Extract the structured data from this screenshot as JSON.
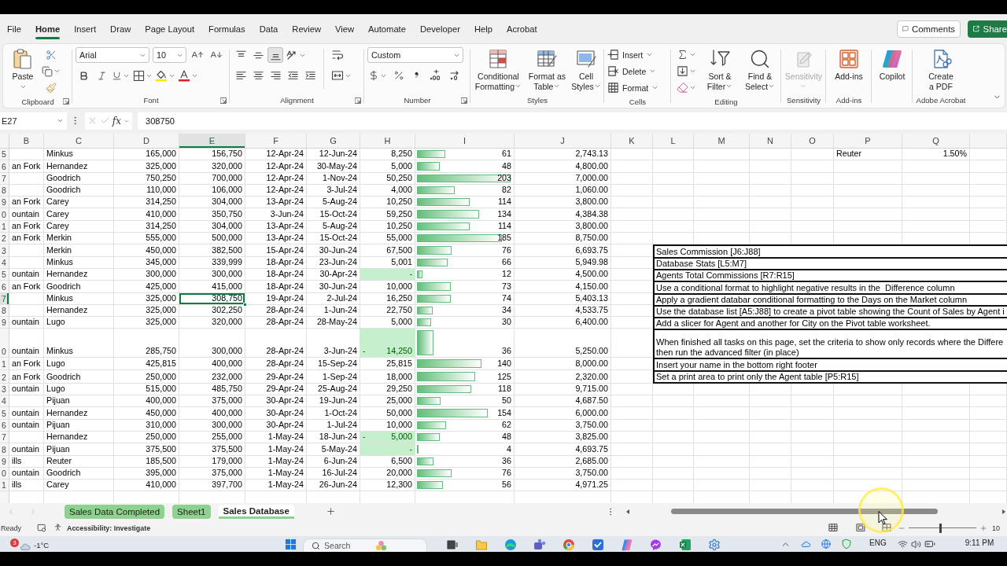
{
  "menu": {
    "tabs": [
      {
        "label": "File",
        "selected": false
      },
      {
        "label": "Home",
        "selected": true
      },
      {
        "label": "Insert",
        "selected": false
      },
      {
        "label": "Draw",
        "selected": false
      },
      {
        "label": "Page Layout",
        "selected": false
      },
      {
        "label": "Formulas",
        "selected": false
      },
      {
        "label": "Data",
        "selected": false
      },
      {
        "label": "Review",
        "selected": false
      },
      {
        "label": "View",
        "selected": false
      },
      {
        "label": "Automate",
        "selected": false
      },
      {
        "label": "Developer",
        "selected": false
      },
      {
        "label": "Help",
        "selected": false
      },
      {
        "label": "Acrobat",
        "selected": false
      }
    ],
    "comments": "Comments",
    "share": "Share"
  },
  "ribbon": {
    "clipboard": {
      "label": "Clipboard",
      "paste": "Paste"
    },
    "font": {
      "label": "Font",
      "font_name": "Arial",
      "font_size": "10"
    },
    "alignment": {
      "label": "Alignment",
      "vertical": [
        {
          "kind": "top",
          "selected": false
        },
        {
          "kind": "middle",
          "selected": false
        },
        {
          "kind": "bottom",
          "selected": true
        }
      ]
    },
    "number": {
      "label": "Number",
      "format": "Custom"
    },
    "styles": {
      "label": "Styles",
      "conditional_formatting": [
        "Conditional",
        "Formatting"
      ],
      "format_as_table": [
        "Format as",
        "Table"
      ],
      "cell_styles": [
        "Cell",
        "Styles"
      ]
    },
    "cells": {
      "label": "Cells",
      "insert": "Insert",
      "delete": "Delete",
      "format": "Format"
    },
    "editing": {
      "label": "Editing",
      "sort_filter": [
        "Sort &",
        "Filter"
      ],
      "find_select": [
        "Find &",
        "Select"
      ]
    },
    "sensitivity": {
      "label": "Sensitivity",
      "button": "Sensitivity",
      "disabled": true
    },
    "add_ins": {
      "label": "Add-ins",
      "button": "Add-ins"
    },
    "copilot": {
      "button": "Copilot"
    },
    "adobe_acrobat": {
      "label": "Adobe Acrobat",
      "create_pdf": [
        "Create",
        "a PDF"
      ]
    }
  },
  "formula_bar": {
    "name_box": "E27",
    "fx": "fx",
    "formula": "308750"
  },
  "sheet": {
    "columns": [
      {
        "label": "B",
        "selected": false
      },
      {
        "label": "C",
        "selected": false
      },
      {
        "label": "D",
        "selected": false
      },
      {
        "label": "E",
        "selected": true
      },
      {
        "label": "F",
        "selected": false
      },
      {
        "label": "G",
        "selected": false
      },
      {
        "label": "H",
        "selected": false
      },
      {
        "label": "I",
        "selected": false
      },
      {
        "label": "J",
        "selected": false
      },
      {
        "label": "K",
        "selected": false
      },
      {
        "label": "L",
        "selected": false
      },
      {
        "label": "M",
        "selected": false
      },
      {
        "label": "N",
        "selected": false
      },
      {
        "label": "O",
        "selected": false
      },
      {
        "label": "P",
        "selected": false
      },
      {
        "label": "Q",
        "selected": false
      }
    ],
    "rows": [
      {
        "header": "5",
        "selected": false,
        "c": "Minkus",
        "d": "165,000",
        "e": "156,750",
        "f": "12-Apr-24",
        "g": "12-Jun-24",
        "h": "8,250",
        "h_highlighted": false,
        "i": "61",
        "level": 0.3,
        "j": "2,743.13",
        "p": "Reuter",
        "q": "1.50%"
      },
      {
        "header": "6",
        "selected": false,
        "b": "an Fork",
        "c": "Hernandez",
        "d": "325,000",
        "e": "320,000",
        "f": "12-Apr-24",
        "g": "30-May-24",
        "h": "5,000",
        "h_highlighted": false,
        "i": "48",
        "level": 0.24,
        "j": "4,800.00"
      },
      {
        "header": "7",
        "selected": false,
        "c": "Goodrich",
        "d": "750,250",
        "e": "700,000",
        "f": "12-Apr-24",
        "g": "1-Nov-24",
        "h": "50,250",
        "h_highlighted": false,
        "i": "203",
        "level": 1,
        "j": "7,000.00"
      },
      {
        "header": "8",
        "selected": false,
        "c": "Goodrich",
        "d": "110,000",
        "e": "106,000",
        "f": "12-Apr-24",
        "g": "3-Jul-24",
        "h": "4,000",
        "h_highlighted": false,
        "i": "82",
        "level": 0.4,
        "j": "1,060.00"
      },
      {
        "header": "9",
        "selected": false,
        "b": "an Fork",
        "c": "Carey",
        "d": "314,250",
        "e": "304,000",
        "f": "13-Apr-24",
        "g": "5-Aug-24",
        "h": "10,250",
        "h_highlighted": false,
        "i": "114",
        "level": 0.56,
        "j": "3,800.00"
      },
      {
        "header": "0",
        "selected": false,
        "b": "ountain",
        "c": "Carey",
        "d": "410,000",
        "e": "350,750",
        "f": "3-Jun-24",
        "g": "15-Oct-24",
        "h": "59,250",
        "h_highlighted": false,
        "i": "134",
        "level": 0.66,
        "j": "4,384.38"
      },
      {
        "header": "1",
        "selected": false,
        "b": "an Fork",
        "c": "Carey",
        "d": "314,250",
        "e": "304,000",
        "f": "13-Apr-24",
        "g": "5-Aug-24",
        "h": "10,250",
        "h_highlighted": false,
        "i": "114",
        "level": 0.56,
        "j": "3,800.00"
      },
      {
        "header": "2",
        "selected": false,
        "b": "an Fork",
        "c": "Merkin",
        "d": "555,000",
        "e": "500,000",
        "f": "13-Apr-24",
        "g": "15-Oct-24",
        "h": "55,000",
        "h_highlighted": false,
        "i": "185",
        "level": 0.91,
        "j": "8,750.00"
      },
      {
        "header": "3",
        "selected": false,
        "c": "Merkin",
        "d": "450,000",
        "e": "382,500",
        "f": "15-Apr-24",
        "g": "30-Jun-24",
        "h": "67,500",
        "h_highlighted": false,
        "i": "76",
        "level": 0.37,
        "j": "6,693.75",
        "note": [
          "Sales Commission [J6:J88]"
        ]
      },
      {
        "header": "4",
        "selected": false,
        "c": "Minkus",
        "d": "345,000",
        "e": "339,999",
        "f": "18-Apr-24",
        "g": "23-Jun-24",
        "h": "5,001",
        "h_highlighted": false,
        "i": "66",
        "level": 0.33,
        "j": "5,949.98",
        "note": [
          "Database Stats [L5:M7]"
        ]
      },
      {
        "header": "5",
        "selected": false,
        "b": "ountain",
        "c": "Hernandez",
        "d": "300,000",
        "e": "300,000",
        "f": "18-Apr-24",
        "g": "30-Apr-24",
        "h": "-",
        "h_highlighted": true,
        "i": "12",
        "level": 0.06,
        "j": "4,500.00",
        "note": [
          "Agents Total Commissions [R7:R15]"
        ]
      },
      {
        "header": "6",
        "selected": false,
        "b": "an Fork",
        "c": "Goodrich",
        "d": "425,000",
        "e": "415,000",
        "f": "18-Apr-24",
        "g": "30-Jun-24",
        "h": "10,000",
        "h_highlighted": false,
        "i": "73",
        "level": 0.36,
        "j": "4,150.00",
        "note": [
          "Use a conditional format to highlight negative results in the  Difference column"
        ]
      },
      {
        "header": "7",
        "selected": true,
        "c": "Minkus",
        "d": "325,000",
        "e": "308,750",
        "f": "19-Apr-24",
        "g": "2-Jul-24",
        "h": "16,250",
        "h_highlighted": false,
        "i": "74",
        "level": 0.36,
        "j": "5,403.13",
        "note": [
          "Apply a gradient databar conditional formatting to the Days on the Market column"
        ]
      },
      {
        "header": "8",
        "selected": false,
        "c": "Hernandez",
        "d": "325,000",
        "e": "302,250",
        "f": "28-Apr-24",
        "g": "1-Jun-24",
        "h": "22,750",
        "h_highlighted": false,
        "i": "34",
        "level": 0.17,
        "j": "4,533.75",
        "note": [
          "Use the database list [A5:J88] to create a pivot table showing the Count of Sales by Agent i"
        ]
      },
      {
        "header": "9",
        "selected": false,
        "b": "ountain",
        "c": "Lugo",
        "d": "325,000",
        "e": "320,000",
        "f": "28-Apr-24",
        "g": "28-May-24",
        "h": "5,000",
        "h_highlighted": false,
        "i": "30",
        "level": 0.15,
        "j": "6,400.00",
        "note": [
          "Add a slicer for Agent and another for City on the Pivot table worksheet."
        ]
      },
      {
        "header": "0",
        "selected": false,
        "b": "ountain",
        "c": "Minkus",
        "d": "285,750",
        "e": "300,000",
        "f": "28-Apr-24",
        "g": "3-Jun-24",
        "h_sign": "-",
        "h": "14,250",
        "h_highlighted": true,
        "i": "36",
        "level": 0.18,
        "j": "5,250.00",
        "note": [
          "When finished all tasks on this page, set the criteria to show only records where the Differe",
          "then run the advanced filter (in place)"
        ]
      },
      {
        "header": "1",
        "selected": false,
        "b": "an Fork",
        "c": "Lugo",
        "d": "425,815",
        "e": "400,000",
        "f": "28-Apr-24",
        "g": "15-Sep-24",
        "h": "25,815",
        "h_highlighted": false,
        "i": "140",
        "level": 0.69,
        "j": "8,000.00",
        "note": [
          "Insert your name in the bottom right footer"
        ]
      },
      {
        "header": "2",
        "selected": false,
        "b": "an Fork",
        "c": "Goodrich",
        "d": "250,000",
        "e": "232,000",
        "f": "29-Apr-24",
        "g": "1-Sep-24",
        "h": "18,000",
        "h_highlighted": false,
        "i": "125",
        "level": 0.62,
        "j": "2,320.00",
        "note": [
          "Set a print area to print only the Agent table [P5:R15]"
        ]
      },
      {
        "header": "3",
        "selected": false,
        "b": "ountain",
        "c": "Lugo",
        "d": "515,000",
        "e": "485,750",
        "f": "29-Apr-24",
        "g": "25-Aug-24",
        "h": "29,250",
        "h_highlighted": false,
        "i": "118",
        "level": 0.58,
        "j": "9,715.00"
      },
      {
        "header": "4",
        "selected": false,
        "c": "Pijuan",
        "d": "400,000",
        "e": "375,000",
        "f": "30-Apr-24",
        "g": "19-Jun-24",
        "h": "25,000",
        "h_highlighted": false,
        "i": "50",
        "level": 0.25,
        "j": "4,687.50"
      },
      {
        "header": "5",
        "selected": false,
        "b": "ountain",
        "c": "Hernandez",
        "d": "450,000",
        "e": "400,000",
        "f": "30-Apr-24",
        "g": "1-Oct-24",
        "h": "50,000",
        "h_highlighted": false,
        "i": "154",
        "level": 0.76,
        "j": "6,000.00"
      },
      {
        "header": "6",
        "selected": false,
        "b": "ountain",
        "c": "Pijuan",
        "d": "310,000",
        "e": "300,000",
        "f": "30-Apr-24",
        "g": "1-Jul-24",
        "h": "10,000",
        "h_highlighted": false,
        "i": "62",
        "level": 0.31,
        "j": "3,750.00"
      },
      {
        "header": "7",
        "selected": false,
        "c": "Hernandez",
        "d": "250,000",
        "e": "255,000",
        "f": "1-May-24",
        "g": "18-Jun-24",
        "h_sign": "-",
        "h": "5,000",
        "h_highlighted": true,
        "i": "48",
        "level": 0.24,
        "j": "3,825.00"
      },
      {
        "header": "8",
        "selected": false,
        "b": "ountain",
        "c": "Pijuan",
        "d": "375,500",
        "e": "375,500",
        "f": "1-May-24",
        "g": "5-May-24",
        "h": "-",
        "h_highlighted": true,
        "i": "4",
        "level": 0.02,
        "j": "4,693.75"
      },
      {
        "header": "9",
        "selected": false,
        "b": "ills",
        "c": "Reuter",
        "d": "185,500",
        "e": "179,000",
        "f": "1-May-24",
        "g": "6-Jun-24",
        "h": "6,500",
        "h_highlighted": false,
        "i": "36",
        "level": 0.18,
        "j": "2,685.00"
      },
      {
        "header": "0",
        "selected": false,
        "b": "ountain",
        "c": "Goodrich",
        "d": "395,000",
        "e": "375,000",
        "f": "1-May-24",
        "g": "16-Jul-24",
        "h": "20,000",
        "h_highlighted": false,
        "i": "76",
        "level": 0.37,
        "j": "3,750.00"
      },
      {
        "header": "1",
        "selected": false,
        "b": "ills",
        "c": "Carey",
        "d": "410,000",
        "e": "397,700",
        "f": "1-May-24",
        "g": "26-Jun-24",
        "h": "12,300",
        "h_highlighted": false,
        "i": "56",
        "level": 0.28,
        "j": "4,971.25"
      }
    ]
  },
  "sheet_tabs": {
    "tabs": [
      {
        "label": "Sales Data Completed",
        "selected": false,
        "color": "#8fd18e"
      },
      {
        "label": "Sheet1",
        "selected": false,
        "color": "#8fd18e"
      },
      {
        "label": "Sales Database",
        "selected": true,
        "color": "#8fd18e"
      }
    ]
  },
  "status_bar": {
    "status": "Ready",
    "accessibility": "Accessibility: Investigate",
    "zoom": {
      "level": 0.46,
      "reading": "10"
    }
  },
  "taskbar": {
    "weather_badge": "3",
    "temperature": "-1°C",
    "search": {
      "placeholder": "Search"
    },
    "language": "ENG",
    "time": "9:11 PM"
  }
}
